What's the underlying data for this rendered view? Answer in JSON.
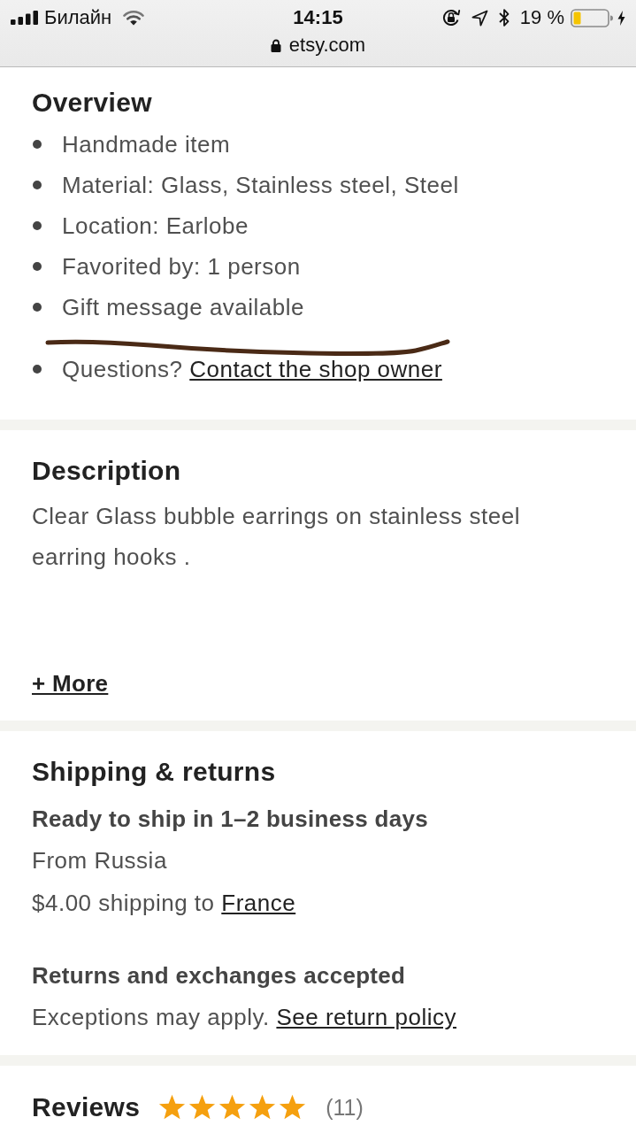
{
  "status_bar": {
    "carrier": "Билайн",
    "time": "14:15",
    "battery_percent": "19 %",
    "url": "etsy.com"
  },
  "overview": {
    "title": "Overview",
    "items": [
      {
        "text": "Handmade item"
      },
      {
        "text": "Material: Glass, Stainless steel, Steel"
      },
      {
        "text": "Location: Earlobe"
      },
      {
        "text": "Favorited by: 1 person"
      },
      {
        "text": "Gift message available"
      },
      {
        "text": "Questions?",
        "link": "Contact the shop owner"
      }
    ]
  },
  "description": {
    "title": "Description",
    "text": "Clear Glass bubble earrings on stainless steel earring hooks .",
    "more_link": "+ More"
  },
  "shipping": {
    "title": "Shipping & returns",
    "ready": "Ready to ship in 1–2 business days",
    "origin": "From Russia",
    "cost_text": "$4.00 shipping to",
    "destination_link": "France",
    "returns_title": "Returns and exchanges accepted",
    "returns_text": "Exceptions may apply.",
    "policy_link": "See return policy"
  },
  "reviews": {
    "title": "Reviews",
    "stars": 5,
    "count": "(11)"
  }
}
